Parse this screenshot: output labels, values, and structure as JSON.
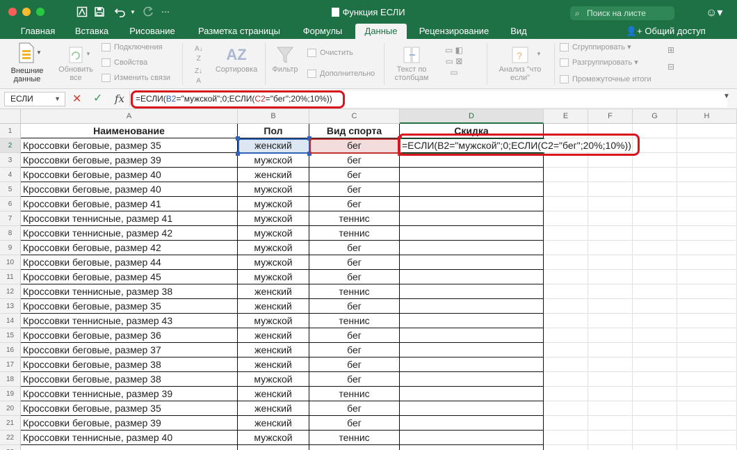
{
  "window": {
    "title": "Функция ЕСЛИ",
    "search_placeholder": "Поиск на листе",
    "share_label": "Общий доступ"
  },
  "tabs": [
    "Главная",
    "Вставка",
    "Рисование",
    "Разметка страницы",
    "Формулы",
    "Данные",
    "Рецензирование",
    "Вид"
  ],
  "active_tab": "Данные",
  "ribbon": {
    "external_data": "Внешние данные",
    "refresh_all": "Обновить все",
    "connections": "Подключения",
    "properties": "Свойства",
    "edit_links": "Изменить связи",
    "sort": "Сортировка",
    "filter": "Фильтр",
    "clear": "Очистить",
    "advanced": "Дополнительно",
    "text_to_columns": "Текст по столбцам",
    "what_if": "Анализ \"что если\"",
    "group": "Сгруппировать",
    "ungroup": "Разгруппировать",
    "subtotals": "Промежуточные итоги"
  },
  "formula_bar": {
    "name_box": "ЕСЛИ",
    "fx_label": "fx",
    "formula_parts": [
      "=ЕСЛИ(",
      "B2",
      "=\"мужской\";0;ЕСЛИ(",
      "C2",
      "=\"бег\";20%;10%))"
    ]
  },
  "columns": [
    "A",
    "B",
    "C",
    "D",
    "E",
    "F",
    "G",
    "H"
  ],
  "headers": [
    "Наименование",
    "Пол",
    "Вид спорта",
    "Скидка"
  ],
  "rows": [
    [
      "Кроссовки беговые, размер 35",
      "женский",
      "бег"
    ],
    [
      "Кроссовки беговые, размер 39",
      "мужской",
      "бег"
    ],
    [
      "Кроссовки беговые, размер 40",
      "женский",
      "бег"
    ],
    [
      "Кроссовки беговые, размер 40",
      "мужской",
      "бег"
    ],
    [
      "Кроссовки беговые, размер 41",
      "мужской",
      "бег"
    ],
    [
      "Кроссовки теннисные, размер 41",
      "мужской",
      "теннис"
    ],
    [
      "Кроссовки теннисные, размер 42",
      "мужской",
      "теннис"
    ],
    [
      "Кроссовки беговые, размер 42",
      "мужской",
      "бег"
    ],
    [
      "Кроссовки беговые, размер 44",
      "мужской",
      "бег"
    ],
    [
      "Кроссовки беговые, размер 45",
      "мужской",
      "бег"
    ],
    [
      "Кроссовки теннисные, размер 38",
      "женский",
      "теннис"
    ],
    [
      "Кроссовки беговые, размер 35",
      "женский",
      "бег"
    ],
    [
      "Кроссовки теннисные, размер 43",
      "мужской",
      "теннис"
    ],
    [
      "Кроссовки беговые, размер 36",
      "женский",
      "бег"
    ],
    [
      "Кроссовки беговые, размер 37",
      "женский",
      "бег"
    ],
    [
      "Кроссовки беговые, размер 38",
      "женский",
      "бег"
    ],
    [
      "Кроссовки беговые, размер 38",
      "мужской",
      "бег"
    ],
    [
      "Кроссовки теннисные, размер 39",
      "женский",
      "теннис"
    ],
    [
      "Кроссовки беговые, размер 35",
      "женский",
      "бег"
    ],
    [
      "Кроссовки беговые, размер 39",
      "женский",
      "бег"
    ],
    [
      "Кроссовки теннисные, размер 40",
      "мужской",
      "теннис"
    ]
  ],
  "active_cell_formula": "=ЕСЛИ(B2=\"мужской\";0;ЕСЛИ(C2=\"бег\";20%;10%))",
  "colors": {
    "excel_green": "#1e7145",
    "callout_red": "#d8141c",
    "ref_blue": "#2f63b7",
    "ref_red": "#c0302e"
  }
}
